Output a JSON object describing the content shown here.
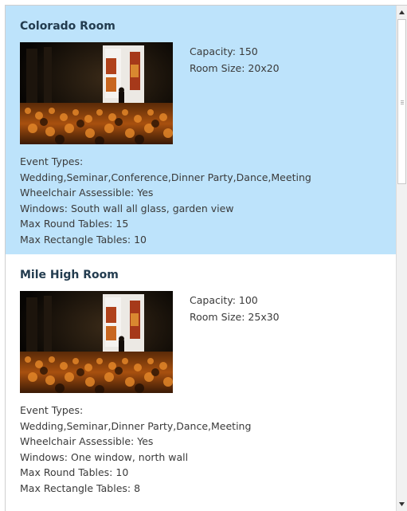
{
  "rooms": [
    {
      "name": "Colorado Room",
      "capacity": "Capacity: 150",
      "room_size": "Room Size: 20x20",
      "event_types_label": "Event Types:",
      "event_types": "Wedding,Seminar,Conference,Dinner Party,Dance,Meeting",
      "wheelchair": "Wheelchair Assessible: Yes",
      "windows": "Windows: South wall all glass, garden view",
      "max_round": "Max Round Tables: 15",
      "max_rect": "Max Rectangle Tables: 10",
      "selected": true,
      "photo_icon": "conference-photo"
    },
    {
      "name": "Mile High Room",
      "capacity": "Capacity: 100",
      "room_size": "Room Size: 25x30",
      "event_types_label": "Event Types:",
      "event_types": "Wedding,Seminar,Dinner Party,Dance,Meeting",
      "wheelchair": "Wheelchair Assessible: Yes",
      "windows": "Windows: One window, north wall",
      "max_round": "Max Round Tables: 10",
      "max_rect": "Max Rectangle Tables: 8",
      "selected": false,
      "photo_icon": "conference-photo"
    }
  ],
  "colors": {
    "selected_background": "#bde3fb",
    "title": "#233c4f",
    "text": "#3a3a3a"
  },
  "scrollbar": {
    "up_icon": "arrow-up-icon",
    "down_icon": "arrow-down-icon"
  }
}
